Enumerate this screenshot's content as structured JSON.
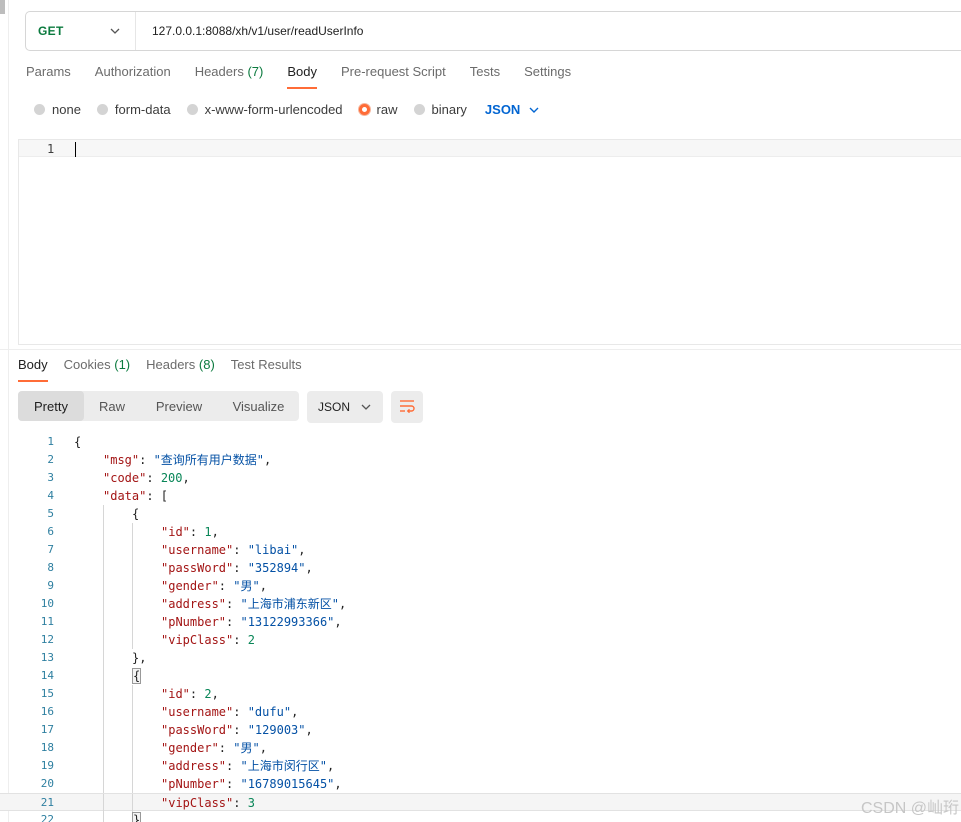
{
  "request": {
    "method": "GET",
    "url": "127.0.0.1:8088/xh/v1/user/readUserInfo"
  },
  "request_tabs": [
    {
      "label": "Params"
    },
    {
      "label": "Authorization"
    },
    {
      "label": "Headers",
      "count": "(7)"
    },
    {
      "label": "Body",
      "active": true
    },
    {
      "label": "Pre-request Script"
    },
    {
      "label": "Tests"
    },
    {
      "label": "Settings"
    }
  ],
  "body_types": {
    "options": [
      "none",
      "form-data",
      "x-www-form-urlencoded",
      "raw",
      "binary"
    ],
    "selected": "raw",
    "language": "JSON"
  },
  "editor": {
    "line_numbers": [
      "1"
    ]
  },
  "response_tabs": [
    {
      "label": "Body",
      "active": true
    },
    {
      "label": "Cookies",
      "count": "(1)"
    },
    {
      "label": "Headers",
      "count": "(8)"
    },
    {
      "label": "Test Results"
    }
  ],
  "view_modes": [
    "Pretty",
    "Raw",
    "Preview",
    "Visualize"
  ],
  "active_view": "Pretty",
  "format": "JSON",
  "response_lines": [
    {
      "n": "1",
      "indent": 0,
      "parts": [
        {
          "t": "p",
          "v": "{"
        }
      ]
    },
    {
      "n": "2",
      "indent": 1,
      "parts": [
        {
          "t": "k",
          "v": "\"msg\""
        },
        {
          "t": "p",
          "v": ": "
        },
        {
          "t": "s",
          "v": "\"查询所有用户数据\""
        },
        {
          "t": "p",
          "v": ","
        }
      ]
    },
    {
      "n": "3",
      "indent": 1,
      "parts": [
        {
          "t": "k",
          "v": "\"code\""
        },
        {
          "t": "p",
          "v": ": "
        },
        {
          "t": "n",
          "v": "200"
        },
        {
          "t": "p",
          "v": ","
        }
      ]
    },
    {
      "n": "4",
      "indent": 1,
      "parts": [
        {
          "t": "k",
          "v": "\"data\""
        },
        {
          "t": "p",
          "v": ": ["
        }
      ]
    },
    {
      "n": "5",
      "indent": 2,
      "parts": [
        {
          "t": "p",
          "v": "{"
        }
      ]
    },
    {
      "n": "6",
      "indent": 3,
      "parts": [
        {
          "t": "k",
          "v": "\"id\""
        },
        {
          "t": "p",
          "v": ": "
        },
        {
          "t": "n",
          "v": "1"
        },
        {
          "t": "p",
          "v": ","
        }
      ]
    },
    {
      "n": "7",
      "indent": 3,
      "parts": [
        {
          "t": "k",
          "v": "\"username\""
        },
        {
          "t": "p",
          "v": ": "
        },
        {
          "t": "s",
          "v": "\"libai\""
        },
        {
          "t": "p",
          "v": ","
        }
      ]
    },
    {
      "n": "8",
      "indent": 3,
      "parts": [
        {
          "t": "k",
          "v": "\"passWord\""
        },
        {
          "t": "p",
          "v": ": "
        },
        {
          "t": "s",
          "v": "\"352894\""
        },
        {
          "t": "p",
          "v": ","
        }
      ]
    },
    {
      "n": "9",
      "indent": 3,
      "parts": [
        {
          "t": "k",
          "v": "\"gender\""
        },
        {
          "t": "p",
          "v": ": "
        },
        {
          "t": "s",
          "v": "\"男\""
        },
        {
          "t": "p",
          "v": ","
        }
      ]
    },
    {
      "n": "10",
      "indent": 3,
      "parts": [
        {
          "t": "k",
          "v": "\"address\""
        },
        {
          "t": "p",
          "v": ": "
        },
        {
          "t": "s",
          "v": "\"上海市浦东新区\""
        },
        {
          "t": "p",
          "v": ","
        }
      ]
    },
    {
      "n": "11",
      "indent": 3,
      "parts": [
        {
          "t": "k",
          "v": "\"pNumber\""
        },
        {
          "t": "p",
          "v": ": "
        },
        {
          "t": "s",
          "v": "\"13122993366\""
        },
        {
          "t": "p",
          "v": ","
        }
      ]
    },
    {
      "n": "12",
      "indent": 3,
      "parts": [
        {
          "t": "k",
          "v": "\"vipClass\""
        },
        {
          "t": "p",
          "v": ": "
        },
        {
          "t": "n",
          "v": "2"
        }
      ]
    },
    {
      "n": "13",
      "indent": 2,
      "parts": [
        {
          "t": "p",
          "v": "},"
        }
      ]
    },
    {
      "n": "14",
      "indent": 2,
      "parts": [
        {
          "t": "b",
          "v": "{"
        }
      ]
    },
    {
      "n": "15",
      "indent": 3,
      "parts": [
        {
          "t": "k",
          "v": "\"id\""
        },
        {
          "t": "p",
          "v": ": "
        },
        {
          "t": "n",
          "v": "2"
        },
        {
          "t": "p",
          "v": ","
        }
      ]
    },
    {
      "n": "16",
      "indent": 3,
      "parts": [
        {
          "t": "k",
          "v": "\"username\""
        },
        {
          "t": "p",
          "v": ": "
        },
        {
          "t": "s",
          "v": "\"dufu\""
        },
        {
          "t": "p",
          "v": ","
        }
      ]
    },
    {
      "n": "17",
      "indent": 3,
      "parts": [
        {
          "t": "k",
          "v": "\"passWord\""
        },
        {
          "t": "p",
          "v": ": "
        },
        {
          "t": "s",
          "v": "\"129003\""
        },
        {
          "t": "p",
          "v": ","
        }
      ]
    },
    {
      "n": "18",
      "indent": 3,
      "parts": [
        {
          "t": "k",
          "v": "\"gender\""
        },
        {
          "t": "p",
          "v": ": "
        },
        {
          "t": "s",
          "v": "\"男\""
        },
        {
          "t": "p",
          "v": ","
        }
      ]
    },
    {
      "n": "19",
      "indent": 3,
      "parts": [
        {
          "t": "k",
          "v": "\"address\""
        },
        {
          "t": "p",
          "v": ": "
        },
        {
          "t": "s",
          "v": "\"上海市闵行区\""
        },
        {
          "t": "p",
          "v": ","
        }
      ]
    },
    {
      "n": "20",
      "indent": 3,
      "parts": [
        {
          "t": "k",
          "v": "\"pNumber\""
        },
        {
          "t": "p",
          "v": ": "
        },
        {
          "t": "s",
          "v": "\"16789015645\""
        },
        {
          "t": "p",
          "v": ","
        }
      ]
    },
    {
      "n": "21",
      "indent": 3,
      "highlight": true,
      "parts": [
        {
          "t": "k",
          "v": "\"vipClass\""
        },
        {
          "t": "p",
          "v": ": "
        },
        {
          "t": "n",
          "v": "3"
        }
      ]
    },
    {
      "n": "22",
      "indent": 2,
      "parts": [
        {
          "t": "b",
          "v": "}"
        }
      ]
    }
  ],
  "watermark": "CSDN @屾珩",
  "colors": {
    "accent": "#ff6c37",
    "method_get": "#0b7a3e",
    "json_key": "#a31515",
    "json_string": "#0451a5",
    "json_number": "#098658",
    "line_number": "#2e7fa0",
    "link_blue": "#0265d2"
  }
}
